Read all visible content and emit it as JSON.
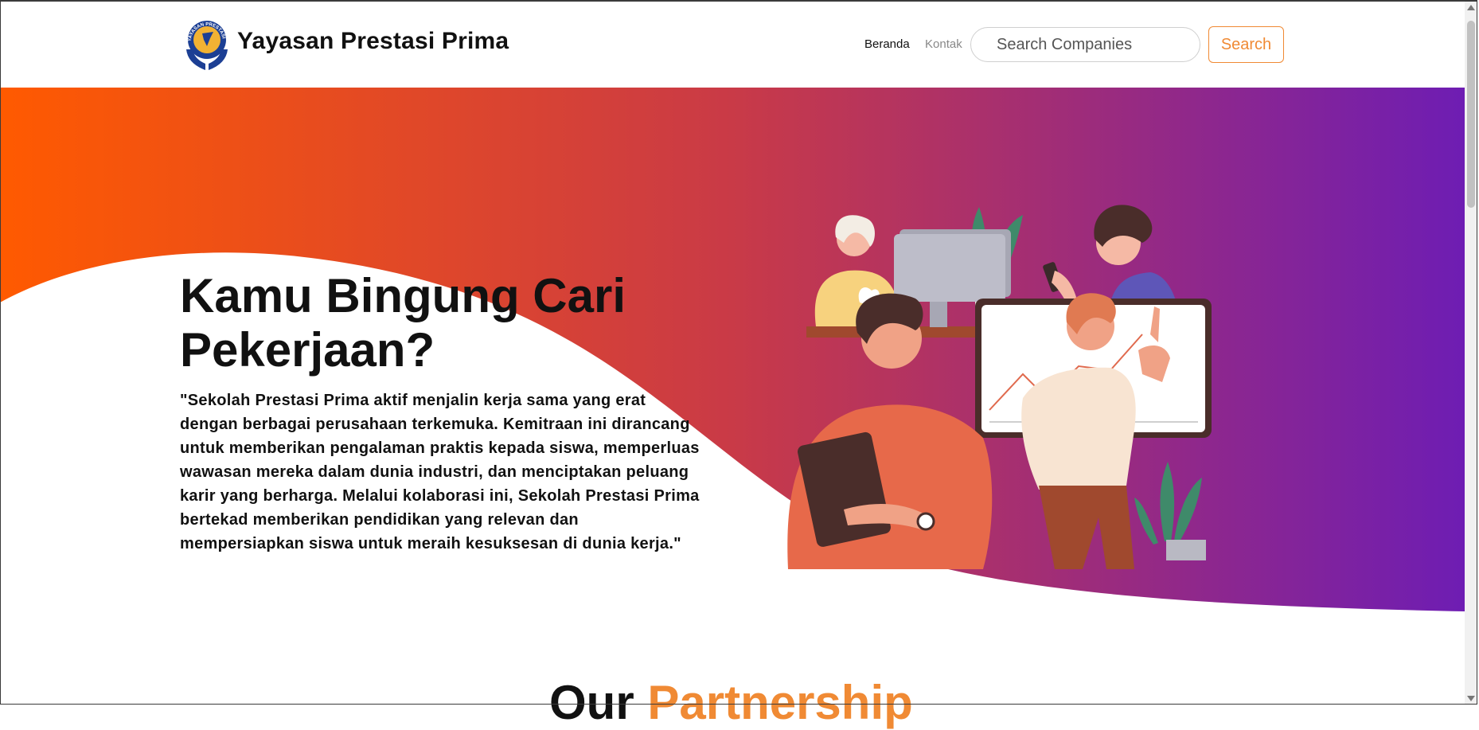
{
  "navbar": {
    "brand_name": "Yayasan Prestasi Prima",
    "logo_ring_text": "YAYASAN PRESTASI PRIMA",
    "links": [
      {
        "label": "Beranda"
      },
      {
        "label": "Kontak"
      }
    ],
    "search_placeholder": "Search Companies",
    "search_button": "Search"
  },
  "hero": {
    "title": "Kamu Bingung Cari Pekerjaan?",
    "quote": "\"Sekolah Prestasi Prima aktif menjalin kerja sama yang erat dengan berbagai perusahaan terkemuka. Kemitraan ini dirancang untuk memberikan pengalaman praktis kepada siswa, memperluas wawasan mereka dalam dunia industri, dan menciptakan peluang karir yang berharga. Melalui kolaborasi ini, Sekolah Prestasi Prima bertekad memberikan pendidikan yang relevan dan mempersiapkan siswa untuk meraih kesuksesan di dunia kerja.\"",
    "illustration": "people-working-illustration"
  },
  "partnership": {
    "heading_main": "Our ",
    "heading_accent": "Partnership"
  },
  "colors": {
    "gradient_start": "#ff5a00",
    "gradient_mid": "#c93a47",
    "gradient_end": "#6e1db3",
    "accent": "#f08a34",
    "logo_blue": "#1c3f94",
    "logo_gold": "#f2b233"
  }
}
